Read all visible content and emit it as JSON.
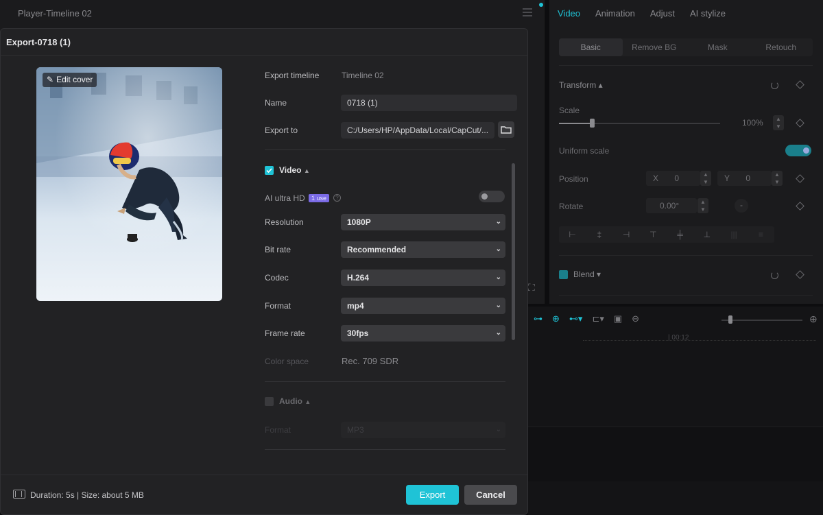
{
  "background": {
    "player_title": "Player-Timeline 02",
    "right_tabs": [
      "Video",
      "Animation",
      "Adjust",
      "AI stylize"
    ],
    "sub_tabs": [
      "Basic",
      "Remove BG",
      "Mask",
      "Retouch"
    ],
    "transform_label": "Transform",
    "scale_label": "Scale",
    "scale_value": "100%",
    "scale_level_percent": 20,
    "uniform_scale_label": "Uniform scale",
    "position_label": "Position",
    "pos_x_label": "X",
    "pos_x_value": "0",
    "pos_y_label": "Y",
    "pos_y_value": "0",
    "rotate_label": "Rotate",
    "rotate_value": "0.00°",
    "blend_label": "Blend",
    "timeline_time": "| 00:12"
  },
  "dialog": {
    "title": "Export-0718 (1)",
    "edit_cover_label": "Edit cover",
    "export_timeline_label": "Export timeline",
    "export_timeline_value": "Timeline 02",
    "name_label": "Name",
    "name_value": "0718 (1)",
    "export_to_label": "Export to",
    "export_to_value": "C:/Users/HP/AppData/Local/CapCut/...",
    "video_section": "Video",
    "ai_ultra_hd_label": "AI ultra HD",
    "ai_badge": "1 use",
    "resolution_label": "Resolution",
    "resolution_value": "1080P",
    "bitrate_label": "Bit rate",
    "bitrate_value": "Recommended",
    "codec_label": "Codec",
    "codec_value": "H.264",
    "format_label": "Format",
    "format_value": "mp4",
    "framerate_label": "Frame rate",
    "framerate_value": "30fps",
    "colorspace_label": "Color space",
    "colorspace_value": "Rec. 709 SDR",
    "audio_section": "Audio",
    "audio_format_label": "Format",
    "audio_format_value": "MP3",
    "duration_text": "Duration: 5s | Size: about 5 MB",
    "export_button": "Export",
    "cancel_button": "Cancel"
  },
  "colors": {
    "accent": "#1fc3d6",
    "dialog_bg": "#222224",
    "badge": "#7b6be6"
  }
}
